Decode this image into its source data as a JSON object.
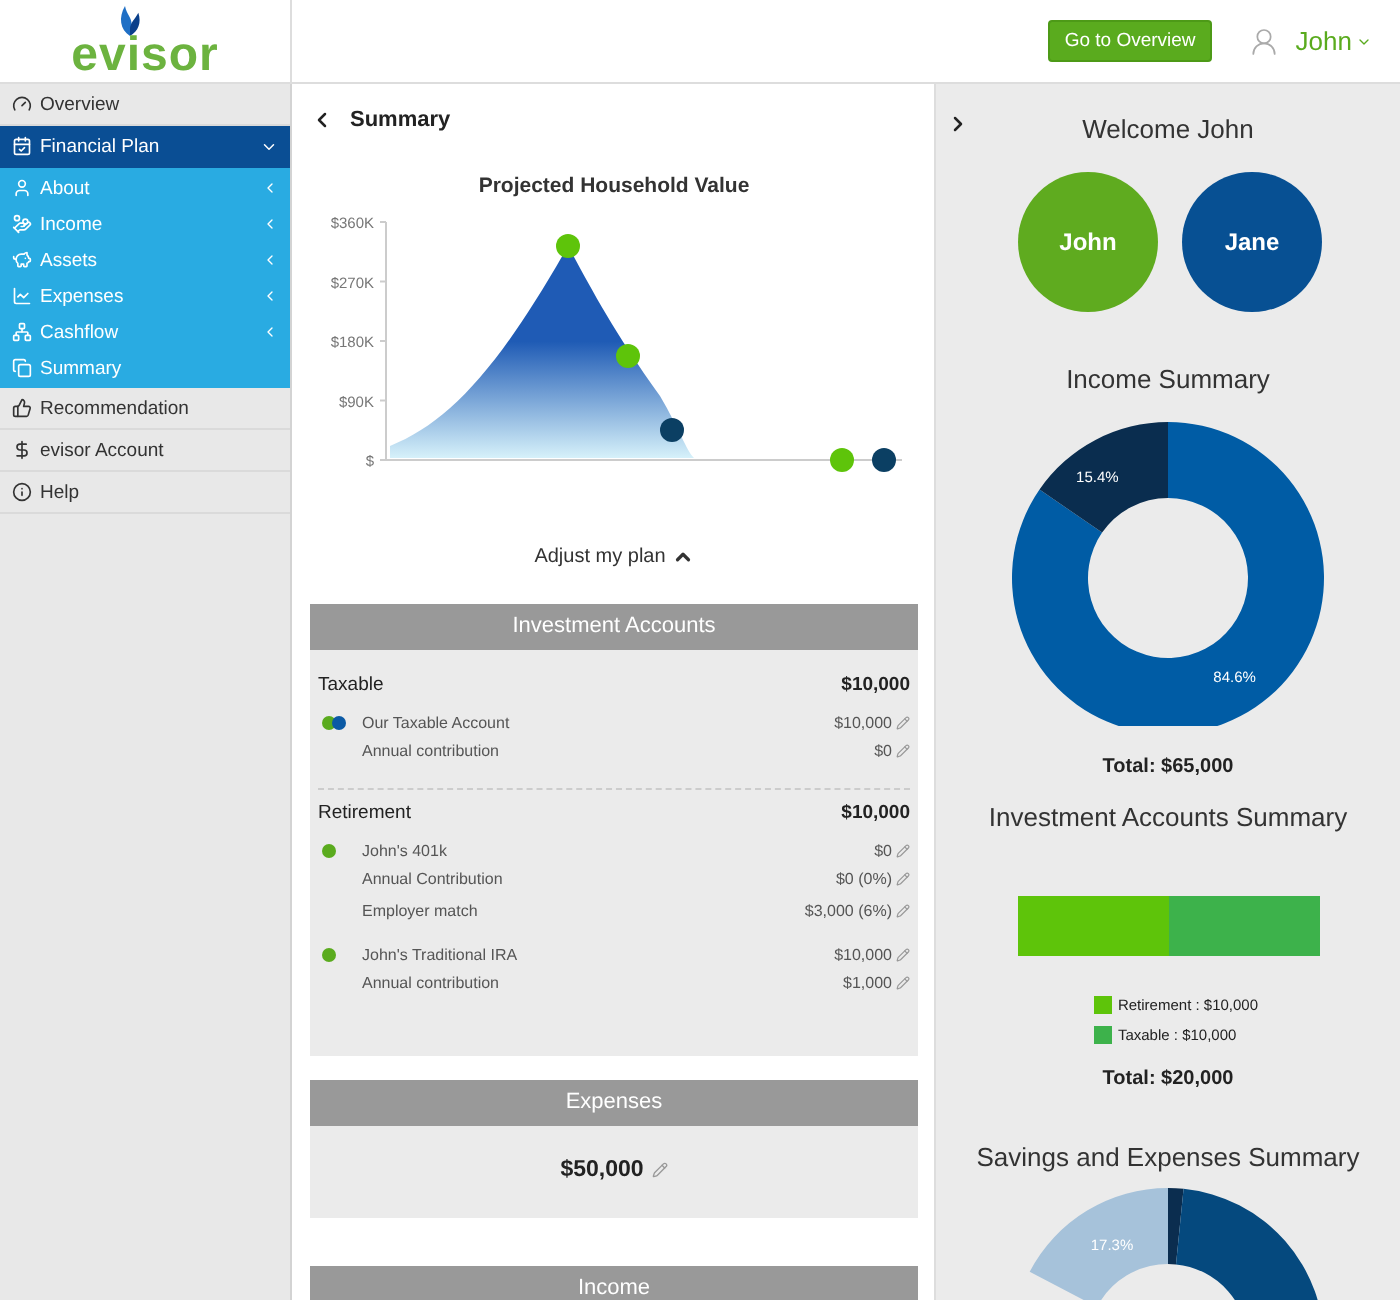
{
  "header": {
    "logo": "evisor",
    "overview_button": "Go to Overview",
    "user": "John"
  },
  "sidebar": [
    {
      "label": "Overview",
      "selected": false
    },
    {
      "label": "Financial Plan",
      "selected": true,
      "expanded": true,
      "children": [
        {
          "label": "About",
          "expandable": true
        },
        {
          "label": "Income",
          "expandable": true
        },
        {
          "label": "Assets",
          "expandable": true
        },
        {
          "label": "Expenses",
          "expandable": true
        },
        {
          "label": "Cashflow",
          "expandable": true
        },
        {
          "label": "Summary",
          "expandable": false
        }
      ]
    },
    {
      "label": "Recommendation",
      "selected": false
    },
    {
      "label": "evisor Account",
      "selected": false
    },
    {
      "label": "Help",
      "selected": false
    }
  ],
  "main": {
    "title": "Summary",
    "chart_title": "Projected Household Value",
    "chart_axis_labels": [
      "$360K",
      "$270K",
      "$180K",
      "$90K",
      "$"
    ],
    "adjust_label": "Adjust my plan",
    "investment_panel": {
      "title": "Investment Accounts",
      "groups": [
        {
          "label": "Taxable",
          "total": "$10,000",
          "accounts": [
            {
              "name": "Our Taxable Account",
              "value": "$10,000",
              "owners": [
                {
                  "color": "#5aab1e"
                },
                {
                  "color": "#0b5aa5"
                }
              ],
              "details": [
                {
                  "label": "Annual contribution",
                  "value": "$0"
                }
              ]
            }
          ]
        },
        {
          "label": "Retirement",
          "total": "$10,000",
          "accounts": [
            {
              "name": "John's 401k",
              "value": "$0",
              "owners": [
                {
                  "color": "#5aab1e"
                }
              ],
              "details": [
                {
                  "label": "Annual Contribution",
                  "value": "$0 (0%)"
                },
                {
                  "label": "Employer match",
                  "value": "$3,000 (6%)"
                }
              ]
            },
            {
              "name": "John's Traditional IRA",
              "value": "$10,000",
              "owners": [
                {
                  "color": "#5aab1e"
                }
              ],
              "details": [
                {
                  "label": "Annual contribution",
                  "value": "$1,000"
                }
              ]
            }
          ]
        }
      ]
    },
    "expenses_panel": {
      "title": "Expenses",
      "amount": "$50,000"
    },
    "income_panel": {
      "title": "Income"
    }
  },
  "right": {
    "welcome": "Welcome John",
    "people": [
      {
        "name": "John",
        "color": "#5fab1f"
      },
      {
        "name": "Jane",
        "color": "#075093"
      }
    ],
    "income_summary": {
      "title": "Income Summary",
      "chart_data": {
        "type": "donut",
        "values": [
          84.6,
          15.4
        ],
        "colors": [
          "#005ca5",
          "#0a2d4f"
        ],
        "value_labels": [
          "84.6%",
          "15.4%"
        ]
      },
      "total": "Total: $65,000"
    },
    "investment_summary": {
      "title": "Investment Accounts Summary",
      "segments": [
        {
          "label": "Retirement : $10,000",
          "color": "#5ec40a",
          "level": 0.5
        },
        {
          "label": "Taxable : $10,000",
          "color": "#3db24b",
          "level": 0.5
        }
      ],
      "total": "Total: $20,000"
    },
    "savings_summary": {
      "title": "Savings and Expenses Summary",
      "label": "17.3%"
    }
  }
}
